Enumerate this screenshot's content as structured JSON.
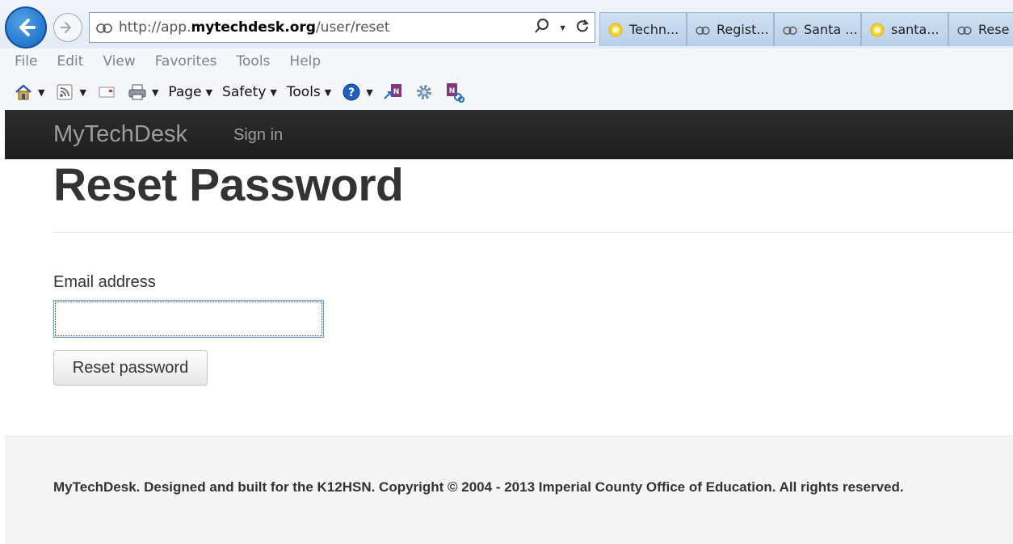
{
  "browser": {
    "url_prefix": "http://app.",
    "url_domain": "mytechdesk.org",
    "url_path": "/user/reset",
    "tabs": [
      {
        "label": "Techn...",
        "icon": "circle-favicon-icon"
      },
      {
        "label": "Regist...",
        "icon": "page-cloud-icon"
      },
      {
        "label": "Santa ...",
        "icon": "page-cloud-icon"
      },
      {
        "label": "santa...",
        "icon": "circle-favicon-icon"
      },
      {
        "label": "Rese",
        "icon": "page-cloud-icon"
      }
    ],
    "menu": [
      "File",
      "Edit",
      "View",
      "Favorites",
      "Tools",
      "Help"
    ],
    "commands": {
      "page": "Page",
      "safety": "Safety",
      "tools": "Tools"
    }
  },
  "navbar": {
    "brand": "MyTechDesk",
    "signin": "Sign in",
    "bg_color": "#222222"
  },
  "main": {
    "title": "Reset Password",
    "email_label": "Email address",
    "email_value": "",
    "reset_button": "Reset password"
  },
  "footer": {
    "text": "MyTechDesk. Designed and built for the K12HSN. Copyright © 2004 - 2013 Imperial County Office of Education. All rights reserved."
  }
}
